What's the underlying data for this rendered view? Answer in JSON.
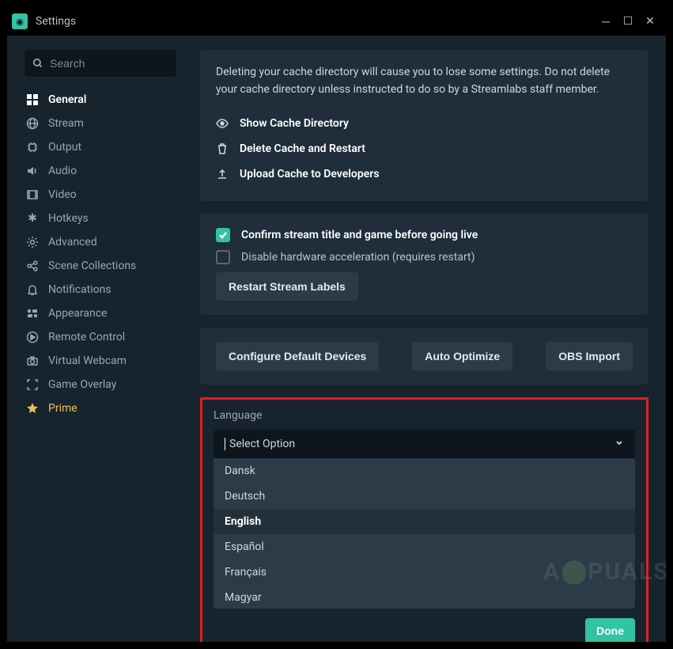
{
  "window": {
    "title": "Settings"
  },
  "search": {
    "placeholder": "Search"
  },
  "sidebar": {
    "items": [
      {
        "label": "General",
        "active": true
      },
      {
        "label": "Stream"
      },
      {
        "label": "Output"
      },
      {
        "label": "Audio"
      },
      {
        "label": "Video"
      },
      {
        "label": "Hotkeys"
      },
      {
        "label": "Advanced"
      },
      {
        "label": "Scene Collections"
      },
      {
        "label": "Notifications"
      },
      {
        "label": "Appearance"
      },
      {
        "label": "Remote Control"
      },
      {
        "label": "Virtual Webcam"
      },
      {
        "label": "Game Overlay"
      },
      {
        "label": "Prime",
        "prime": true
      }
    ]
  },
  "cache_panel": {
    "text": "Deleting your cache directory will cause you to lose some settings. Do not delete your cache directory unless instructed to do so by a Streamlabs staff member.",
    "actions": {
      "show": "Show Cache Directory",
      "delete": "Delete Cache and Restart",
      "upload": "Upload Cache to Developers"
    }
  },
  "stream_panel": {
    "confirm_label": "Confirm stream title and game before going live",
    "confirm_checked": true,
    "disable_hw_label": "Disable hardware acceleration (requires restart)",
    "disable_hw_checked": false,
    "restart_button": "Restart Stream Labels"
  },
  "action_buttons": {
    "configure": "Configure Default Devices",
    "auto_optimize": "Auto Optimize",
    "obs_import": "OBS Import"
  },
  "language": {
    "label": "Language",
    "placeholder": "Select Option",
    "selected": "English",
    "options": [
      "Dansk",
      "Deutsch",
      "English",
      "Español",
      "Français",
      "Magyar"
    ]
  },
  "done_button": "Done"
}
